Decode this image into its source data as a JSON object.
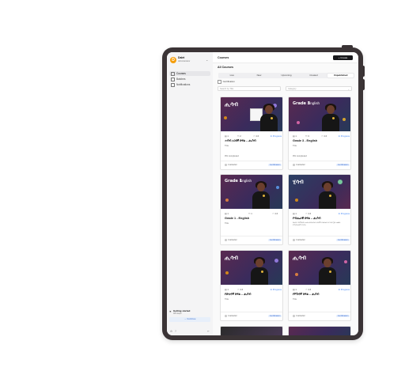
{
  "colors": {
    "frame": "#3b3436",
    "accent": "#3b82f6",
    "brand": "#f59e0b"
  },
  "sidebar": {
    "org_name": "Dalet",
    "org_role": "Administrator",
    "items": [
      {
        "label": "Courses",
        "icon": "book-icon",
        "active": true
      },
      {
        "label": "Batches",
        "icon": "users-icon",
        "active": false
      },
      {
        "label": "Notifications",
        "icon": "bell-icon",
        "active": false
      }
    ],
    "getting_started": {
      "title": "Getting started",
      "subtitle": "0/8 steps",
      "button": "Continue"
    }
  },
  "header": {
    "title": "Courses",
    "create_label": "Create"
  },
  "section_title": "All Courses",
  "tabs": [
    "Live",
    "New",
    "Upcoming",
    "Created",
    "Unpublished"
  ],
  "active_tab": 4,
  "filters": {
    "certification_label": "Certification",
    "search_placeholder": "Search by Title",
    "category_placeholder": "Category"
  },
  "courses": [
    {
      "title": "ሐሳብ አንደኛ ክፍል – ሒሳብ",
      "type": "Title",
      "lessons": "1",
      "students": "2",
      "rating": "4.6",
      "progress": "In Progress",
      "completed": "0% completed",
      "instructor": "Instructor",
      "tag": "Certification",
      "thumb_title": "ሒሳብ",
      "thumb_sub": ""
    },
    {
      "title": "Grade 3 - English",
      "type": "Title",
      "lessons": "1",
      "students": "3",
      "rating": "4.6",
      "progress": "In Progress",
      "completed": "0% completed",
      "instructor": "Instructor",
      "tag": "Certification",
      "thumb_title": "Grade 3",
      "thumb_sub": "English"
    },
    {
      "title": "Grade 1 - English",
      "type": "Title",
      "lessons": "1",
      "students": "1",
      "rating": "4.6",
      "progress": "",
      "completed": "",
      "instructor": "Instructor",
      "tag": "Certification",
      "thumb_title": "Grade 1",
      "thumb_sub": "English"
    },
    {
      "title": "የብሔራዊ ክፍል – ሒሳብ",
      "type": "",
      "desc": "የቁጥር ትምህርት መሰረታዊ ጽንሰ ሀሳቦችን በቀላሉ እና በተሟላ መልኩ የሚያስተምር ኮርስ",
      "lessons": "1",
      "students": "",
      "rating": "4.6",
      "progress": "In Progress",
      "completed": "",
      "instructor": "Instructor",
      "tag": "Certification",
      "thumb_title": "ሂሳብ",
      "thumb_sub": ""
    },
    {
      "title": "የሁለተኛ ክፍል – ሒሳብ",
      "type": "Title",
      "lessons": "1",
      "students": "",
      "rating": "4.6",
      "progress": "In Progress",
      "completed": "",
      "instructor": "Instructor",
      "tag": "Certification",
      "thumb_title": "ሒሳብ",
      "thumb_sub": ""
    },
    {
      "title": "የሦስተኛ ክፍል – ሒሳብ",
      "type": "Title",
      "lessons": "1",
      "students": "",
      "rating": "4.6",
      "progress": "In Progress",
      "completed": "",
      "instructor": "Instructor",
      "tag": "Certification",
      "thumb_title": "ሒሳብ",
      "thumb_sub": ""
    }
  ]
}
